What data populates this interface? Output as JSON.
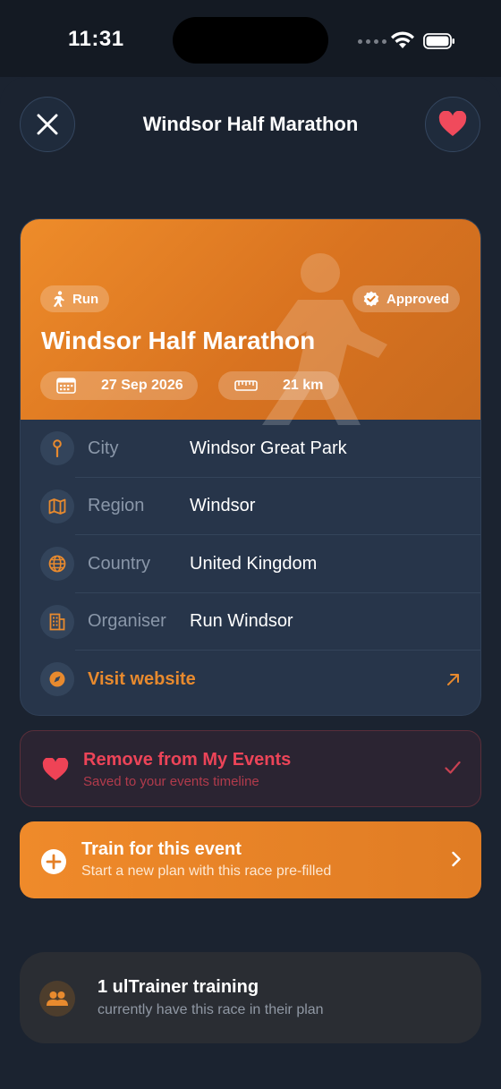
{
  "status_bar": {
    "time": "11:31"
  },
  "header": {
    "title": "Windsor Half Marathon"
  },
  "event": {
    "sport": "Run",
    "status": "Approved",
    "name": "Windsor Half Marathon",
    "date": "27 Sep 2026",
    "distance": "21 km"
  },
  "details": [
    {
      "label": "City",
      "value": "Windsor Great Park",
      "icon": "map-pin-icon"
    },
    {
      "label": "Region",
      "value": "Windsor",
      "icon": "map-icon"
    },
    {
      "label": "Country",
      "value": "United Kingdom",
      "icon": "globe-icon"
    },
    {
      "label": "Organiser",
      "value": "Run Windsor",
      "icon": "building-icon"
    }
  ],
  "website": {
    "label": "Visit website"
  },
  "my_events": {
    "title": "Remove from My Events",
    "subtitle": "Saved to your events timeline"
  },
  "train": {
    "title": "Train for this event",
    "subtitle": "Start a new plan with this race pre-filled"
  },
  "trainers": {
    "title": "1 ulTrainer training",
    "subtitle": "currently have this race in their plan"
  },
  "colors": {
    "background": "#1b2330",
    "accent_orange": "#e88a2e",
    "danger_red": "#ec4458",
    "card": "#27354a"
  }
}
